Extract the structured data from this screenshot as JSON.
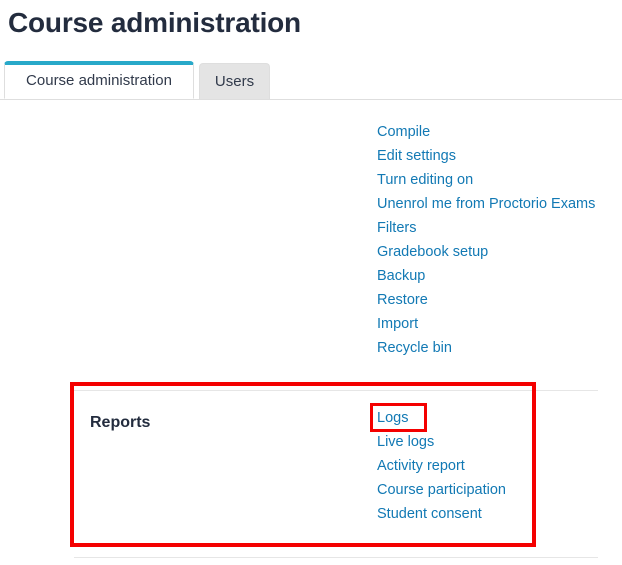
{
  "page": {
    "title": "Course administration"
  },
  "tabs": [
    {
      "label": "Course administration",
      "name": "tab-course-administration",
      "active": true
    },
    {
      "label": "Users",
      "name": "tab-users",
      "active": false
    }
  ],
  "sections": [
    {
      "id": "main",
      "heading": "",
      "links": [
        {
          "label": "Compile"
        },
        {
          "label": "Edit settings"
        },
        {
          "label": "Turn editing on"
        },
        {
          "label": "Unenrol me from Proctorio Exams"
        },
        {
          "label": "Filters"
        },
        {
          "label": "Gradebook setup"
        },
        {
          "label": "Backup"
        },
        {
          "label": "Restore"
        },
        {
          "label": "Import"
        },
        {
          "label": "Recycle bin"
        }
      ]
    },
    {
      "id": "reports",
      "heading": "Reports",
      "links": [
        {
          "label": "Logs",
          "highlighted": true
        },
        {
          "label": "Live logs"
        },
        {
          "label": "Activity report"
        },
        {
          "label": "Course participation"
        },
        {
          "label": "Student consent"
        }
      ]
    }
  ],
  "annotations": [
    {
      "name": "reports-section-highlight",
      "color": "#f40000"
    },
    {
      "name": "logs-link-highlight",
      "color": "#f40000"
    }
  ],
  "colors": {
    "link": "#1279b4",
    "heading": "#232c3e",
    "active_tab_accent": "#28a9c9",
    "inactive_tab_bg": "#e4e4e4",
    "divider": "#e6e6e6",
    "annotation": "#f40000"
  }
}
